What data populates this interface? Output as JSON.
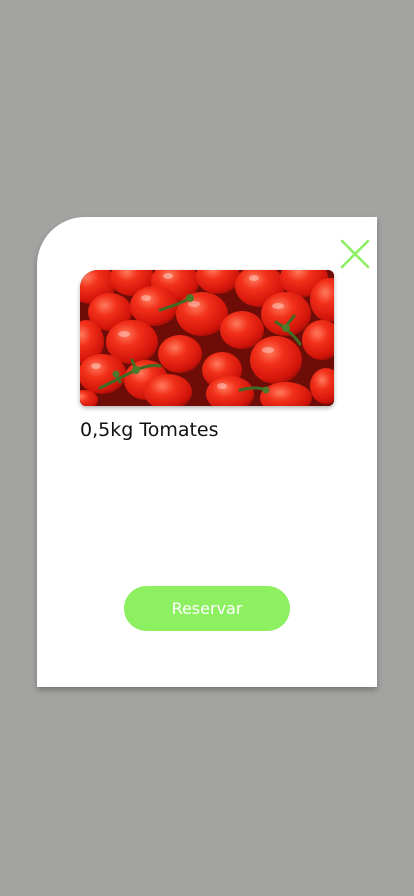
{
  "product": {
    "title": "0,5kg Tomates",
    "image_subject": "tomatoes"
  },
  "actions": {
    "reserve_label": "Reservar",
    "close_icon": "close-icon"
  },
  "colors": {
    "overlay": "#a3a3a1",
    "accent": "#8df061",
    "card": "#ffffff",
    "tomato": "#e8200c"
  }
}
